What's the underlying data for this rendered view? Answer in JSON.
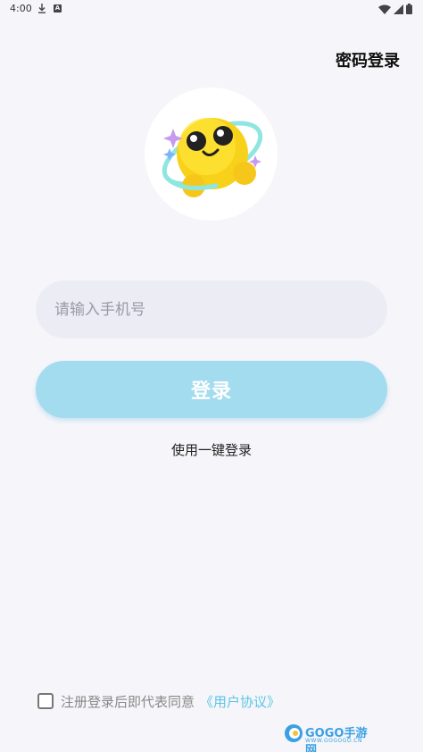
{
  "status_bar": {
    "time": "4:00",
    "a_glyph": "A"
  },
  "header": {
    "password_login": "密码登录"
  },
  "avatar": {
    "icon": "smiley-planet-mascot"
  },
  "phone_field": {
    "placeholder": "请输入手机号",
    "value": ""
  },
  "login_button": {
    "label": "登录"
  },
  "one_key_login": {
    "label": "使用一键登录"
  },
  "agreement": {
    "text": "注册登录后即代表同意",
    "link": "《用户协议》"
  },
  "watermark": {
    "brand": "GOGO手游网",
    "url": "WWW.GOGOGO.CN"
  },
  "colors": {
    "accent": "#a3dbef",
    "link": "#5cc4e4",
    "input_bg": "#ececf4",
    "background": "#f6f6fa"
  }
}
